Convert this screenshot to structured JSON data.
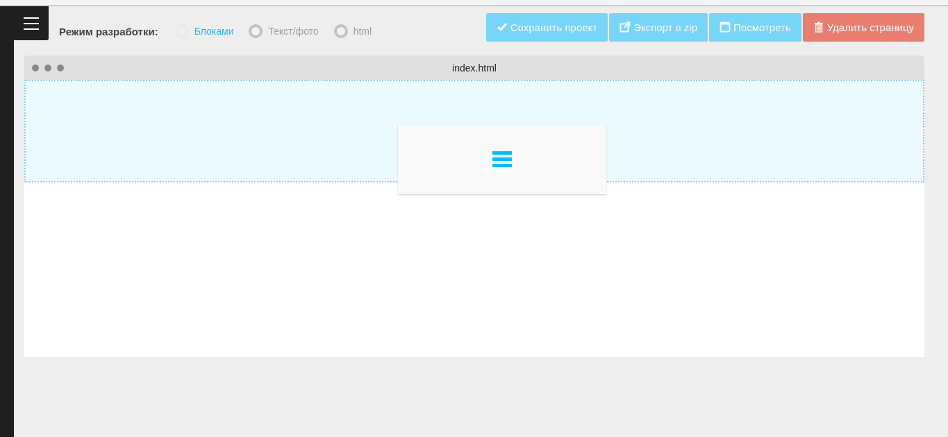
{
  "mode": {
    "label": "Режим разработки:",
    "options": [
      {
        "label": "Блоками",
        "selected": true
      },
      {
        "label": "Текст/фото",
        "selected": false
      },
      {
        "label": "html",
        "selected": false
      }
    ]
  },
  "buttons": [
    {
      "kind": "save",
      "label": "Сохранить проект"
    },
    {
      "kind": "export",
      "label": "Экспорт в zip"
    },
    {
      "kind": "preview",
      "label": "Посмотреть"
    },
    {
      "kind": "delete",
      "label": "Удалить страницу"
    }
  ],
  "frame": {
    "title": "index.html"
  }
}
